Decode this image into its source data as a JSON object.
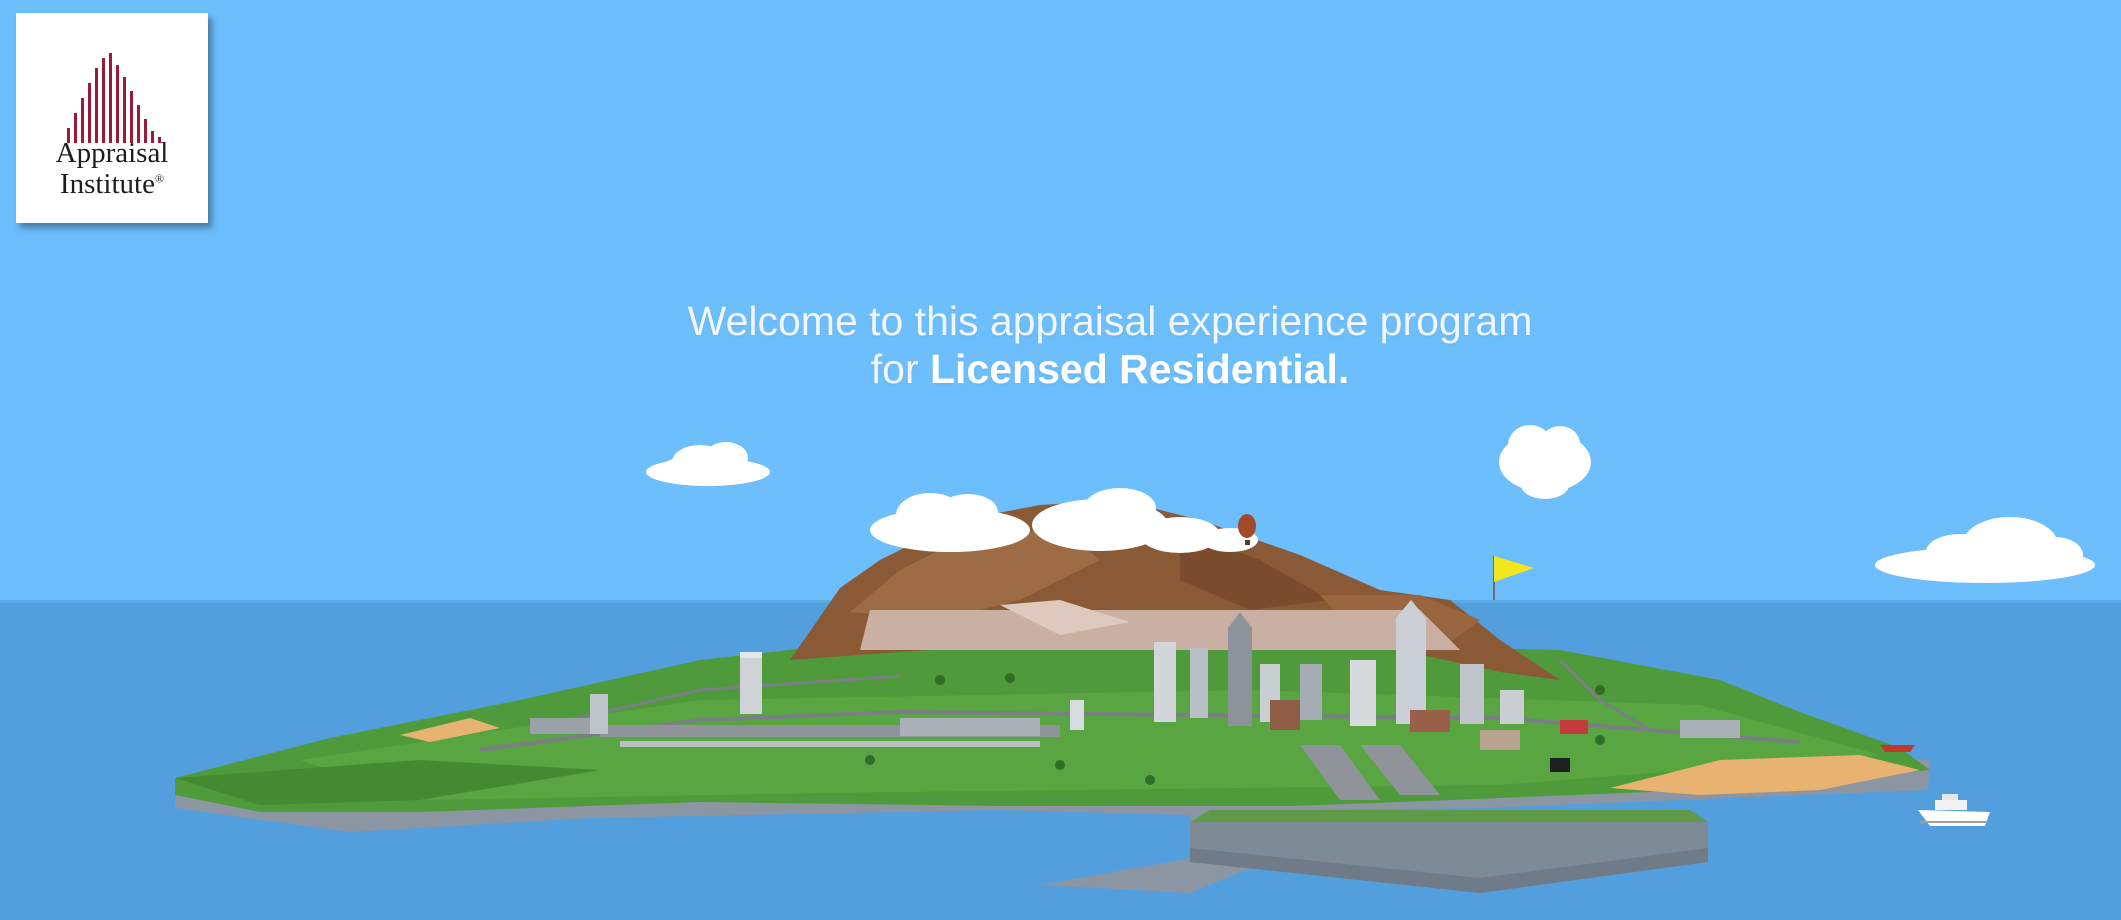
{
  "logo": {
    "line1": "Appraisal",
    "line2": "Institute",
    "registered": "®",
    "mark_color": "#9b1a3a",
    "mark_icon": "appraisal-institute-bars-icon"
  },
  "welcome": {
    "line1": "Welcome to this appraisal experience program",
    "line2_prefix": "for ",
    "line2_highlight": "Licensed Residential."
  },
  "scene": {
    "sky_color": "#6dbefc",
    "sea_color": "#539fde",
    "island_green": "#4e9a3a",
    "mountain_brown": "#8a5a37",
    "flag_color": "#f4e51c"
  }
}
